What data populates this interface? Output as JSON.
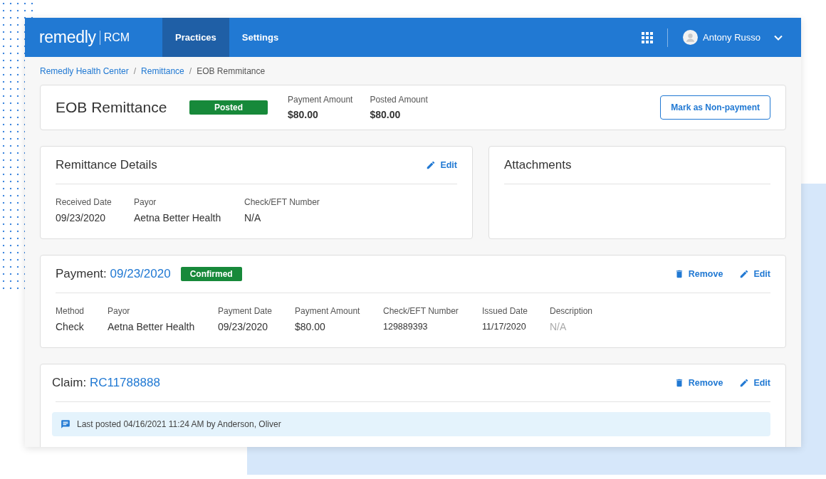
{
  "header": {
    "logo": {
      "brand": "remedly",
      "product": "RCM"
    },
    "nav": [
      {
        "label": "Practices",
        "selected": true
      },
      {
        "label": "Settings",
        "selected": false
      }
    ],
    "user": {
      "name": "Antony Russo"
    }
  },
  "breadcrumb_separator": "/",
  "breadcrumb": [
    {
      "label": "Remedly Health Center",
      "kind": "link"
    },
    {
      "label": "Remittance",
      "kind": "link"
    },
    {
      "label": "EOB Remmitance",
      "kind": "current"
    }
  ],
  "summary": {
    "title": "EOB Remittance",
    "status": "Posted",
    "amounts": [
      {
        "label": "Payment Amount",
        "value": "$80.00"
      },
      {
        "label": "Posted Amount",
        "value": "$80.00"
      }
    ],
    "action": "Mark as Non-payment"
  },
  "remittance_details": {
    "title": "Remittance Details",
    "actions": [
      {
        "label": "Edit",
        "kind": "edit"
      }
    ],
    "fields": [
      {
        "label": "Received Date",
        "value": "09/23/2020",
        "muted": false
      },
      {
        "label": "Payor",
        "value": "Aetna Better Health",
        "muted": false
      },
      {
        "label": "Check/EFT Number",
        "value": "N/A",
        "muted": false
      }
    ]
  },
  "attachments": {
    "title": "Attachments"
  },
  "payment": {
    "title": "Payment:",
    "link": "09/23/2020",
    "status": "Confirmed",
    "actions": [
      {
        "label": "Remove",
        "kind": "remove"
      },
      {
        "label": "Edit",
        "kind": "edit"
      }
    ],
    "fields": [
      {
        "label": "Method",
        "value": "Check",
        "muted": false,
        "small": false
      },
      {
        "label": "Payor",
        "value": "Aetna Better Health",
        "muted": false,
        "small": false
      },
      {
        "label": "Payment Date",
        "value": "09/23/2020",
        "muted": false,
        "small": false
      },
      {
        "label": "Payment Amount",
        "value": "$80.00",
        "muted": false,
        "small": false
      },
      {
        "label": "Check/EFT Number",
        "value": "129889393",
        "muted": false,
        "small": true
      },
      {
        "label": "Issued Date",
        "value": "11/17/2020",
        "muted": false,
        "small": true
      },
      {
        "label": "Description",
        "value": "N/A",
        "muted": true,
        "small": false
      }
    ]
  },
  "claim": {
    "title": "Claim:",
    "link": "RC11788888",
    "actions": [
      {
        "label": "Remove",
        "kind": "remove"
      },
      {
        "label": "Edit",
        "kind": "edit"
      }
    ],
    "note": "Last posted 04/16/2021 11:24 AM by Anderson, Oliver"
  }
}
